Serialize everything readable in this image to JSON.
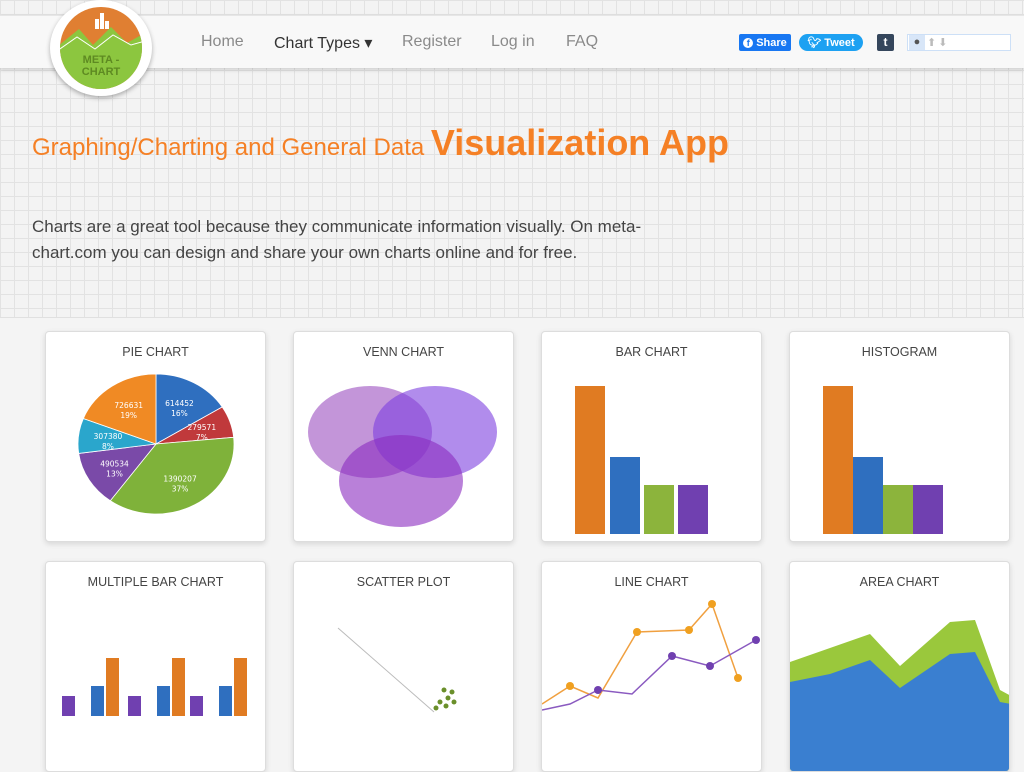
{
  "logo": {
    "text": "META - CHART"
  },
  "nav": {
    "items": [
      {
        "label": "Home"
      },
      {
        "label": "Chart Types ▾"
      },
      {
        "label": "Register"
      },
      {
        "label": "Log in"
      },
      {
        "label": "FAQ"
      }
    ]
  },
  "social": {
    "facebook": "Share",
    "twitter": "Tweet",
    "tumblr": "t",
    "reddit_up": "⬆",
    "reddit_down": "⬇"
  },
  "hero": {
    "title_small": "Graphing/Charting and General Data ",
    "title_big": "Visualization App",
    "lead": "Charts are a great tool because they communicate information visually. On meta-chart.com you can design and share your own charts online and for free.",
    "accent": "#f58025"
  },
  "cards": [
    {
      "title": "PIE CHART"
    },
    {
      "title": "VENN CHART"
    },
    {
      "title": "BAR CHART"
    },
    {
      "title": "HISTOGRAM"
    },
    {
      "title": "MULTIPLE BAR CHART"
    },
    {
      "title": "SCATTER PLOT"
    },
    {
      "title": "LINE CHART"
    },
    {
      "title": "AREA CHART"
    }
  ],
  "pie": {
    "slices": [
      {
        "value": "614452",
        "pct": "16%",
        "color": "#2f6fbf"
      },
      {
        "value": "279571",
        "pct": "7%",
        "color": "#c0393b"
      },
      {
        "value": "1390207",
        "pct": "37%",
        "color": "#7fb23a"
      },
      {
        "value": "490534",
        "pct": "13%",
        "color": "#7a4aa8"
      },
      {
        "value": "307380",
        "pct": "8%",
        "color": "#2aa6cc"
      },
      {
        "value": "726631",
        "pct": "19%",
        "color": "#f08a24"
      }
    ]
  }
}
